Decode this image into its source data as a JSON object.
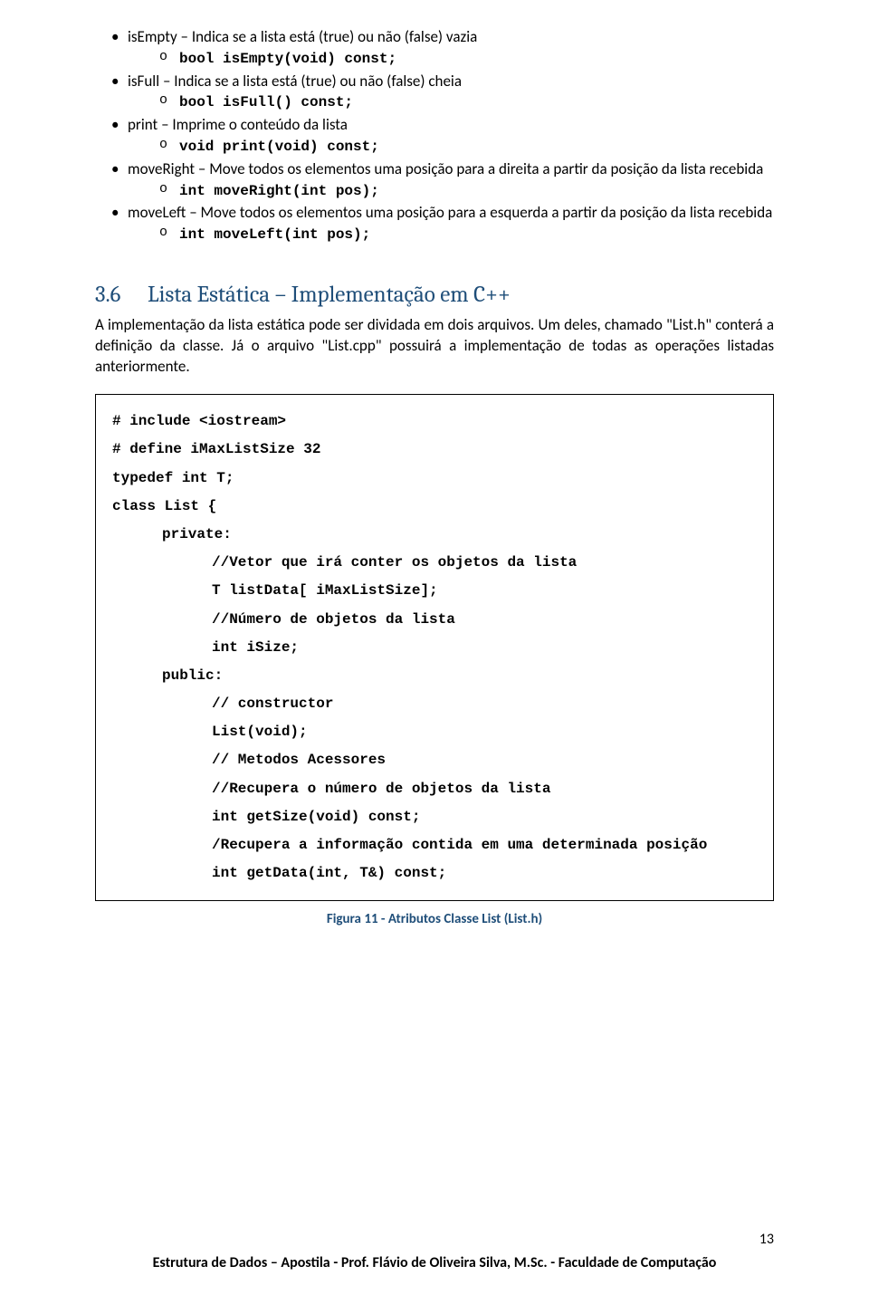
{
  "bullets": {
    "b0": "isEmpty – Indica se a lista está (true) ou não (false) vazia",
    "b0s": "bool isEmpty(void) const;",
    "b1": "isFull – Indica se a lista está (true) ou não (false) cheia",
    "b1s": "bool isFull() const;",
    "b2": "print – Imprime o conteúdo da lista",
    "b2s": "void print(void) const;",
    "b3": "moveRight – Move todos os elementos uma posição para a direita a partir da posição da lista recebida",
    "b3s": "int moveRight(int pos);",
    "b4": "moveLeft – Move todos os elementos uma posição para a esquerda a partir da posição da lista recebida",
    "b4s": "int moveLeft(int pos);"
  },
  "section": {
    "num": "3.6",
    "title": "Lista Estática – Implementação em C++"
  },
  "para": "A implementação da lista estática pode ser dividada em dois arquivos. Um deles, chamado \"List.h\" conterá a definição da classe. Já o arquivo \"List.cpp\" possuirá a implementação de todas as operações listadas anteriormente.",
  "code": {
    "l0": "# include <iostream>",
    "l1": "# define iMaxListSize 32",
    "l2": "typedef int T;",
    "l3": "class List {",
    "l4": "private:",
    "l5": "//Vetor que irá conter os objetos da lista",
    "l6": "T listData[ iMaxListSize];",
    "l7": "//Número de objetos da lista",
    "l8": "int iSize;",
    "l9": "public:",
    "l10": "// constructor",
    "l11": "List(void);",
    "l12": "// Metodos Acessores",
    "l13": "//Recupera o número de objetos da lista",
    "l14": "int getSize(void) const;",
    "l15": "/Recupera a informação contida em uma determinada posição",
    "l16": "int getData(int, T&) const;"
  },
  "caption": "Figura 11 - Atributos Classe List (List.h)",
  "pagenum": "13",
  "footer": "Estrutura de Dados – Apostila - Prof. Flávio de Oliveira Silva, M.Sc. - Faculdade de Computação"
}
